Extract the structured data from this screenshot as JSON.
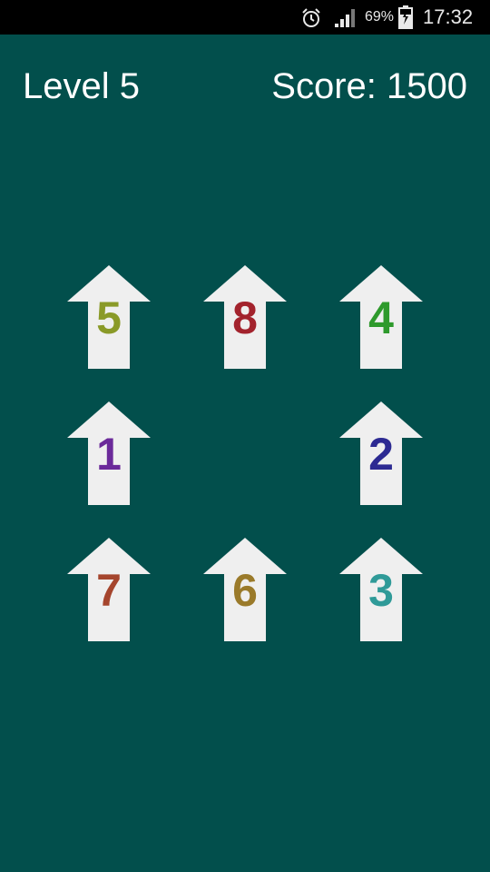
{
  "status_bar": {
    "battery_percent": "69%",
    "time": "17:32",
    "icons": [
      "alarm-icon",
      "signal-icon",
      "battery-charging-icon"
    ]
  },
  "hud": {
    "level": "Level 5",
    "score": "Score: 1500"
  },
  "board": {
    "tile_direction": "up",
    "tile_color": "#efefef",
    "background_color": "#024f4c",
    "tiles": [
      {
        "row": 1,
        "col": 1,
        "number": "5",
        "color": "#8a9a28"
      },
      {
        "row": 1,
        "col": 2,
        "number": "8",
        "color": "#a3232d"
      },
      {
        "row": 1,
        "col": 3,
        "number": "4",
        "color": "#2e9a2c"
      },
      {
        "row": 2,
        "col": 1,
        "number": "1",
        "color": "#6b2a9a"
      },
      {
        "row": 2,
        "col": 3,
        "number": "2",
        "color": "#2c2a92"
      },
      {
        "row": 3,
        "col": 1,
        "number": "7",
        "color": "#a5452d"
      },
      {
        "row": 3,
        "col": 2,
        "number": "6",
        "color": "#9a7a2a"
      },
      {
        "row": 3,
        "col": 3,
        "number": "3",
        "color": "#2f9a98"
      }
    ]
  }
}
